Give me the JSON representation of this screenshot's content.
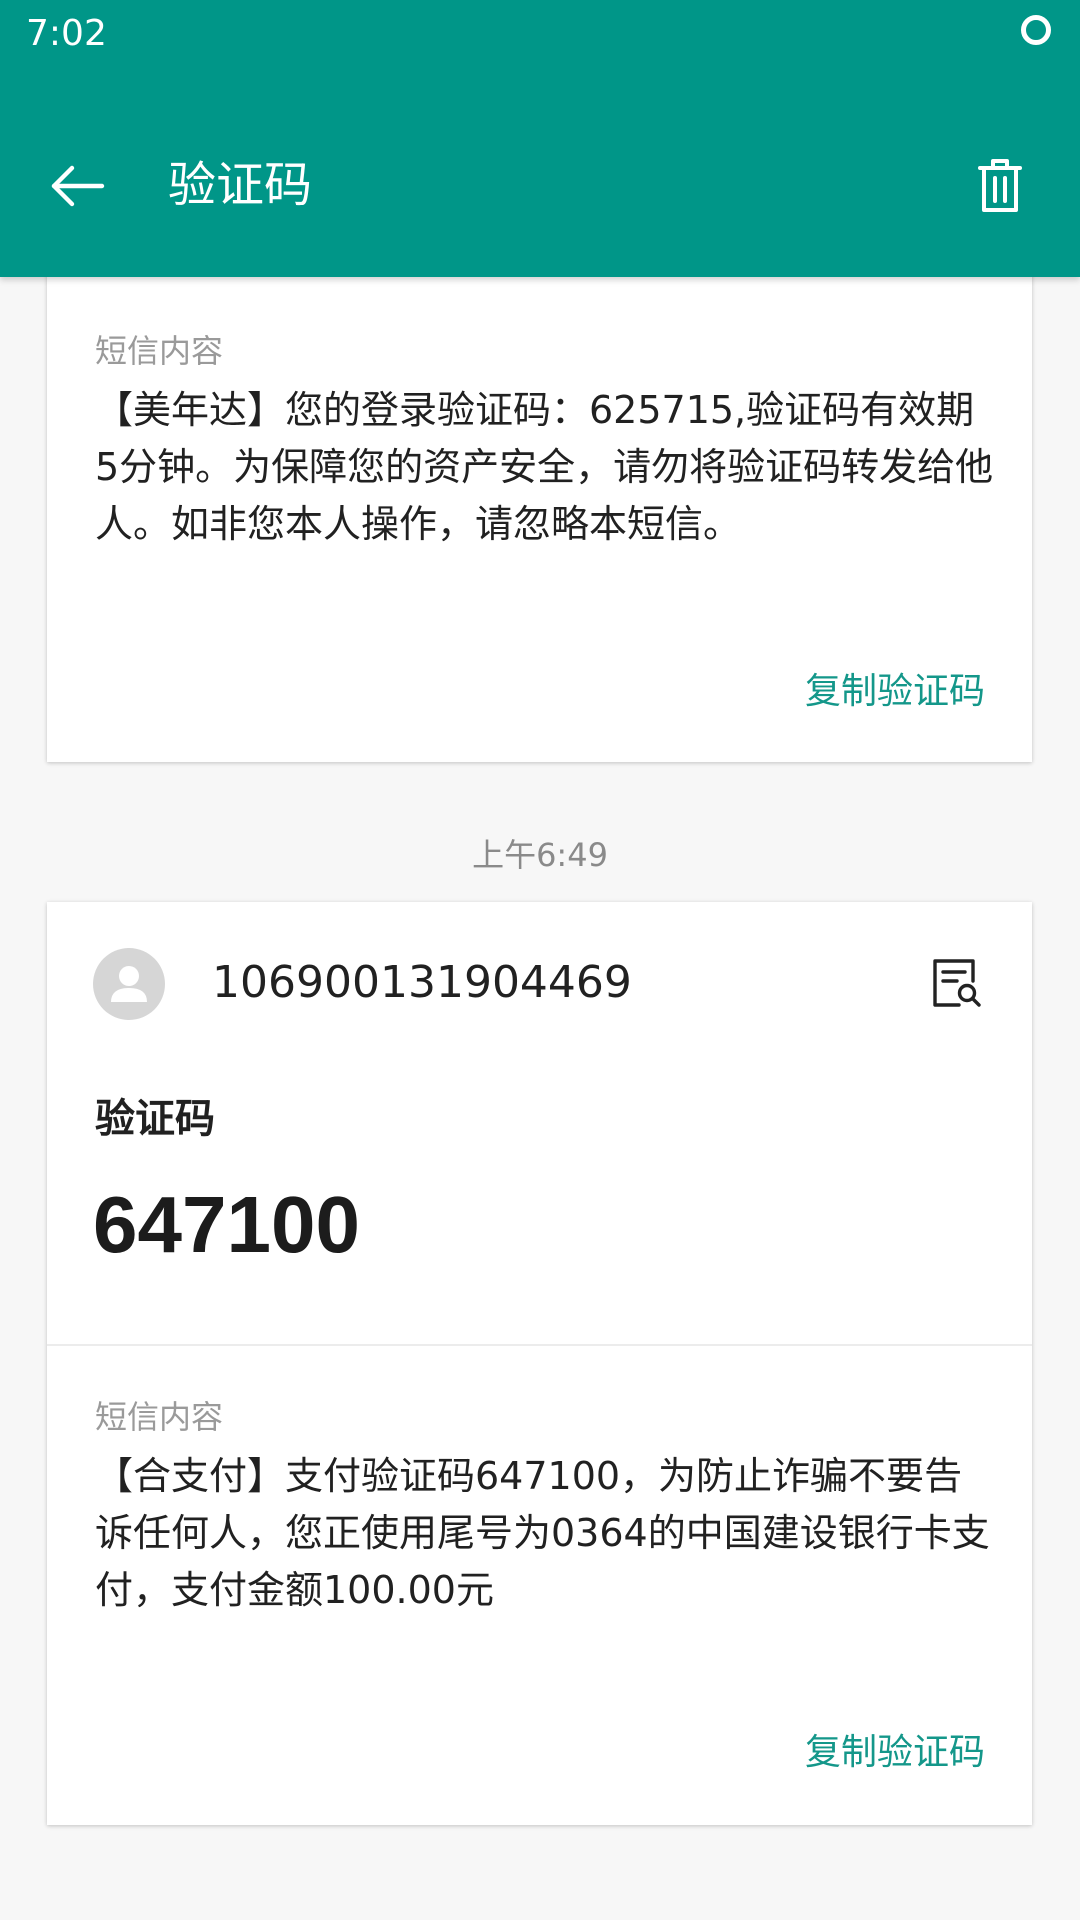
{
  "status_bar": {
    "time": "7:02"
  },
  "app_bar": {
    "title": "验证码"
  },
  "messages": [
    {
      "content_label": "短信内容",
      "body": "【美年达】您的登录验证码：625715,验证码有效期5分钟。为保障您的资产安全，请勿将验证码转发给他人。如非您本人操作，请忽略本短信。",
      "copy_label": "复制验证码"
    },
    {
      "time": "上午6:49",
      "sender": "106900131904469",
      "code_title": "验证码",
      "code": "647100",
      "content_label": "短信内容",
      "body": "【合支付】支付验证码647100，为防止诈骗不要告诉任何人，您正使用尾号为0364的中国建设银行卡支付，支付金额100.00元",
      "copy_label": "复制验证码"
    }
  ],
  "colors": {
    "primary": "#009688",
    "accent_text": "#14978a",
    "background": "#f7f7f7"
  },
  "icons": {
    "back": "arrow-back-icon",
    "delete": "trash-icon",
    "status": "sync-ring-icon",
    "avatar": "person-avatar-icon",
    "detail": "document-search-icon"
  }
}
